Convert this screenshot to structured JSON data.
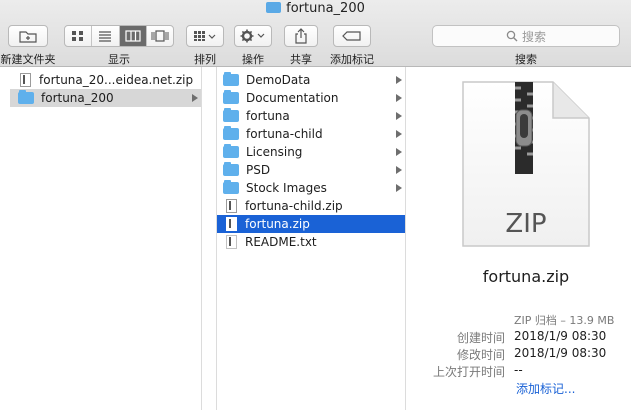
{
  "window": {
    "title": "fortuna_200"
  },
  "toolbar": {
    "new_folder_label": "新建文件夹",
    "view_label": "显示",
    "sort_label": "排列",
    "action_label": "操作",
    "share_label": "共享",
    "tags_label": "添加标记",
    "search_label": "搜索",
    "search_placeholder": "搜索"
  },
  "column1": {
    "items": [
      {
        "name": "fortuna_20...eidea.net.zip",
        "type": "file"
      },
      {
        "name": "fortuna_200",
        "type": "folder",
        "selected": true
      }
    ]
  },
  "column2": {
    "items": [
      {
        "name": "DemoData",
        "type": "folder"
      },
      {
        "name": "Documentation",
        "type": "folder"
      },
      {
        "name": "fortuna",
        "type": "folder"
      },
      {
        "name": "fortuna-child",
        "type": "folder"
      },
      {
        "name": "Licensing",
        "type": "folder"
      },
      {
        "name": "PSD",
        "type": "folder"
      },
      {
        "name": "Stock Images",
        "type": "folder"
      },
      {
        "name": "fortuna-child.zip",
        "type": "file"
      },
      {
        "name": "fortuna.zip",
        "type": "file",
        "selected": true
      },
      {
        "name": "README.txt",
        "type": "file"
      }
    ]
  },
  "preview": {
    "icon_label": "ZIP",
    "filename": "fortuna.zip",
    "kind_size": "ZIP 归档 – 13.9 MB",
    "created_label": "创建时间",
    "created_value": "2018/1/9 08:30",
    "modified_label": "修改时间",
    "modified_value": "2018/1/9 08:30",
    "opened_label": "上次打开时间",
    "opened_value": "--",
    "add_tags": "添加标记..."
  },
  "colors": {
    "selection_blue": "#1a62d6",
    "folder_blue": "#5fb0ec",
    "link_blue": "#1a62d6"
  }
}
